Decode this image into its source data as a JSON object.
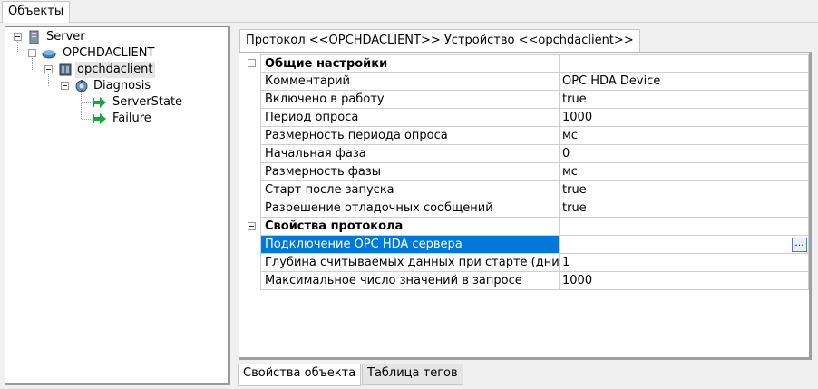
{
  "top_tabs": [
    {
      "label": "Объекты"
    }
  ],
  "tree": {
    "server": {
      "label": "Server",
      "icon": "server-icon"
    },
    "opc_client": {
      "label": "OPCHDACLIENT",
      "icon": "protocol-icon"
    },
    "device": {
      "label": "opchdaclient",
      "icon": "device-icon"
    },
    "diagnosis": {
      "label": "Diagnosis",
      "icon": "diagnosis-icon"
    },
    "tags": [
      {
        "label": "ServerState",
        "icon": "green-arrow-icon"
      },
      {
        "label": "Failure",
        "icon": "green-arrow-icon"
      }
    ]
  },
  "inner_tab": {
    "label": "Протокол <<OPCHDACLIENT>> Устройство <<opchdaclient>>"
  },
  "properties": {
    "general_header": "Общие настройки",
    "general": [
      {
        "key": "Комментарий",
        "value": "OPC HDA Device"
      },
      {
        "key": "Включено в работу",
        "value": "true"
      },
      {
        "key": "Период опроса",
        "value": "1000"
      },
      {
        "key": "Размерность периода опроса",
        "value": "мс"
      },
      {
        "key": "Начальная фаза",
        "value": "0"
      },
      {
        "key": "Размерность фазы",
        "value": "мс"
      },
      {
        "key": "Старт после запуска",
        "value": "true"
      },
      {
        "key": "Разрешение отладочных сообщений",
        "value": "true"
      }
    ],
    "protocol_header": "Свойства протокола",
    "protocol": [
      {
        "key": "Подключение OPC HDA сервера",
        "value": ""
      },
      {
        "key": "Глубина считываемых данных при старте (дни)",
        "value": "1"
      },
      {
        "key": "Максимальное число значений в запросе",
        "value": "1000"
      }
    ],
    "ellipsis_label": "..."
  },
  "bottom_tabs": [
    {
      "label": "Свойства объекта"
    },
    {
      "label": "Таблица тегов"
    }
  ],
  "colors": {
    "selection": "#0078d7",
    "arrow": "#1aa83a"
  }
}
